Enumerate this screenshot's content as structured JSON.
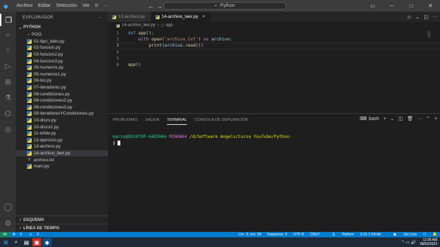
{
  "titlebar": {
    "menu": [
      "Archivo",
      "Editar",
      "Selección",
      "Ver",
      "Ir"
    ],
    "more": "···",
    "search": "Python"
  },
  "activity": {
    "icons": [
      "explorer-icon",
      "search-icon",
      "source-control-icon",
      "run-debug-icon",
      "extensions-icon",
      "testing-icon",
      "python-icon",
      "remote-icon",
      "account-icon",
      "settings-icon"
    ]
  },
  "sidebar": {
    "title": "EXPLORADOR",
    "more": "···",
    "folder": "PYTHON",
    "items": [
      {
        "label": "POO",
        "type": "folder"
      },
      {
        "label": "01-tipo_dato.py",
        "type": "py"
      },
      {
        "label": "02-funcion.py",
        "type": "py"
      },
      {
        "label": "03-funcion2.py",
        "type": "py"
      },
      {
        "label": "04-funcion3.py",
        "type": "py"
      },
      {
        "label": "05-numeros.py",
        "type": "py"
      },
      {
        "label": "05-numeros1.py",
        "type": "py"
      },
      {
        "label": "06-list.py",
        "type": "py"
      },
      {
        "label": "07-iteradores.py",
        "type": "py"
      },
      {
        "label": "08-condiciones.py",
        "type": "py"
      },
      {
        "label": "08-condiciones2.py",
        "type": "py"
      },
      {
        "label": "08-condiciones3.py",
        "type": "py"
      },
      {
        "label": "09-iteradoresYCondiciones.py",
        "type": "py"
      },
      {
        "label": "10-discs.py",
        "type": "py"
      },
      {
        "label": "10-discs2.py",
        "type": "py"
      },
      {
        "label": "11-while.py",
        "type": "py"
      },
      {
        "label": "12-ejercicio.py",
        "type": "py"
      },
      {
        "label": "13-archivo.py",
        "type": "py"
      },
      {
        "label": "14-archivo_leer.py",
        "type": "py",
        "selected": true
      },
      {
        "label": "archivo.txt",
        "type": "txt"
      },
      {
        "label": "main.py",
        "type": "py"
      }
    ],
    "bottom_sections": [
      "ESQUEMA",
      "LÍNEA DE TIEMPO"
    ]
  },
  "editor": {
    "tabs": [
      {
        "label": "13-archivo.py",
        "active": false
      },
      {
        "label": "14-archivo_leer.py",
        "active": true
      }
    ],
    "breadcrumb": {
      "file": "14-archivo_leer.py",
      "symbol": "app"
    },
    "line_numbers": [
      "1",
      "2",
      "3",
      "4",
      "5",
      "6"
    ],
    "current_line": 3
  },
  "panel": {
    "tabs": [
      "PROBLEMAS",
      "SALIDA",
      "TERMINAL",
      "CONSOLA DE DEPURACIÓN"
    ],
    "active_tab": "TERMINAL",
    "shell": "bash",
    "terminal": {
      "user": "marco@DESKTOP-6ADIH6A",
      "system": "MINGW64",
      "path": "/d/Software Angels/Curso YouTube/Python",
      "prompt": "$"
    }
  },
  "statusbar": {
    "errors": "0",
    "warnings": "0",
    "position": "Lín. 3, col. 29",
    "spaces": "Espacios: 4",
    "encoding": "UTF-8",
    "eol": "CRLF",
    "language": "Python",
    "interpreter": "3.11.1 64-bit",
    "golive": "Go Live"
  },
  "taskbar": {
    "time": "11:05 AM",
    "date": "08/02/2023"
  },
  "colors": {
    "statusbar": "#007acc",
    "activitybar": "#333333",
    "sidebar": "#252526",
    "editor": "#1e1e1e"
  }
}
